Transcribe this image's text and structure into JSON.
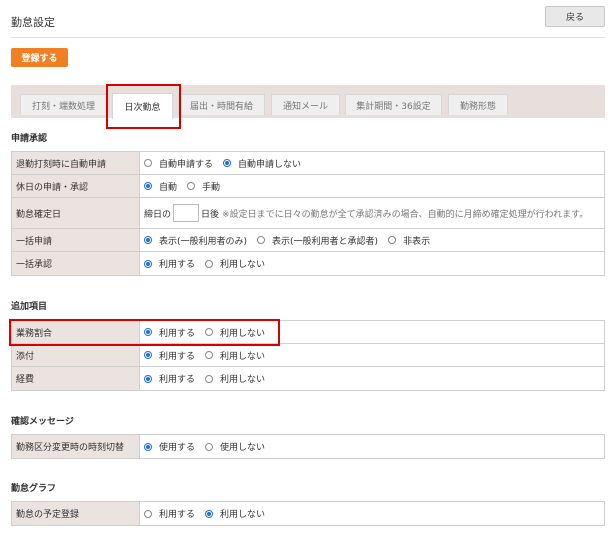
{
  "header": {
    "title": "勤怠設定",
    "back_label": "戻る"
  },
  "toolbar": {
    "register_label": "登録する"
  },
  "tabs": [
    {
      "label": "打刻・端数処理"
    },
    {
      "label": "日次勤怠"
    },
    {
      "label": "届出・時間有給"
    },
    {
      "label": "通知メール"
    },
    {
      "label": "集計期間・36設定"
    },
    {
      "label": "勤務形態"
    }
  ],
  "active_tab": "日次勤怠",
  "sections": {
    "approval": {
      "title": "申請承認",
      "rows": [
        {
          "label": "退勤打刻時に自動申請",
          "options": [
            "自動申請する",
            "自動申請しない"
          ],
          "selected": "自動申請しない"
        },
        {
          "label": "休日の申請・承認",
          "options": [
            "自動",
            "手動"
          ],
          "selected": "自動"
        },
        {
          "label": "勤怠確定日",
          "prefix": "締日の",
          "suffix": "日後",
          "value": "",
          "note": "※設定日までに日々の勤怠が全て承認済みの場合、自動的に月締め確定処理が行われます。"
        },
        {
          "label": "一括申請",
          "options": [
            "表示(一般利用者のみ)",
            "表示(一般利用者と承認者)",
            "非表示"
          ],
          "selected": "表示(一般利用者のみ)"
        },
        {
          "label": "一括承認",
          "options": [
            "利用する",
            "利用しない"
          ],
          "selected": "利用する"
        }
      ]
    },
    "additional": {
      "title": "追加項目",
      "rows": [
        {
          "label": "業務割合",
          "options": [
            "利用する",
            "利用しない"
          ],
          "selected": "利用する"
        },
        {
          "label": "添付",
          "options": [
            "利用する",
            "利用しない"
          ],
          "selected": "利用する"
        },
        {
          "label": "経費",
          "options": [
            "利用する",
            "利用しない"
          ],
          "selected": "利用する"
        }
      ]
    },
    "confirm": {
      "title": "確認メッセージ",
      "rows": [
        {
          "label": "勤務区分変更時の時刻切替",
          "options": [
            "使用する",
            "使用しない"
          ],
          "selected": "使用する"
        }
      ]
    },
    "graph": {
      "title": "勤怠グラフ",
      "rows": [
        {
          "label": "勤怠の予定登録",
          "options": [
            "利用する",
            "利用しない"
          ],
          "selected": "利用しない"
        }
      ]
    }
  },
  "colors": {
    "accent": "#f08023",
    "highlight": "#d50000",
    "radio_on": "#1e6fd9",
    "label_bg": "#ebe3e0"
  }
}
